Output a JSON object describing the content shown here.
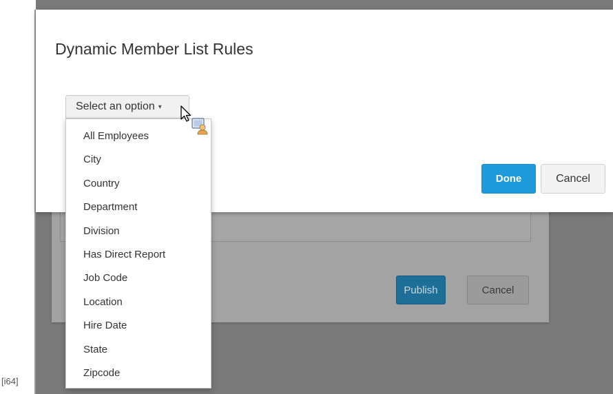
{
  "dialog": {
    "title": "Dynamic Member List Rules",
    "select": {
      "label": "Select an option",
      "caret": "▾"
    },
    "done_label": "Done",
    "cancel_label": "Cancel"
  },
  "dropdown": {
    "items": [
      "All Employees",
      "City",
      "Country",
      "Department",
      "Division",
      "Has Direct Report",
      "Job Code",
      "Location",
      "Hire Date",
      "State",
      "Zipcode"
    ]
  },
  "background_dialog": {
    "publish_label": "Publish",
    "cancel_label": "Cancel"
  },
  "caption": "[i64]",
  "colors": {
    "primary": "#1e9bdb",
    "overlay": "#7a7a7a"
  },
  "icons": [
    "mouse-pointer-icon",
    "user-card-icon",
    "caret-down-icon"
  ]
}
